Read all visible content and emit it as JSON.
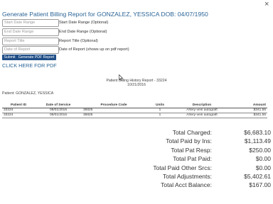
{
  "header": {
    "title": "Generate Patient Billing Report for GONZALEZ, YESSICA DOB: 04/07/1950",
    "close_glyph": "×"
  },
  "form": {
    "fields": [
      {
        "placeholder": "Start Date Range",
        "label": "Start Date Range (Optional)"
      },
      {
        "placeholder": "End Date Range",
        "label": "End Date Range (Optional)"
      },
      {
        "placeholder": "Report Title",
        "label": "Report Title (Optional)"
      },
      {
        "placeholder": "Date of Report",
        "label": "Date of Report (shows up on pdf report)"
      }
    ],
    "submit_label": "Submit",
    "generate_pdf_label": "Generate PDF Report",
    "pdf_link": "CLICK HERE FOR PDF"
  },
  "report": {
    "title": "Patient Billing History Report - 33224",
    "date": "10/21/2016",
    "patient_line": "Patient: GONZALEZ, YESSICA",
    "columns": [
      "Patient ID",
      "Date of Service",
      "Procedure Code",
      "Units",
      "Description",
      "Amount"
    ],
    "rows": [
      [
        "33224",
        "08/01/2016",
        "36825",
        "1",
        "Artery-vein autograft",
        "$341.55"
      ],
      [
        "33224",
        "08/01/2016",
        "36825",
        "1",
        "Artery-vein autograft",
        "$341.55"
      ]
    ]
  },
  "totals": [
    {
      "label": "Total Charged:",
      "value": "$6,683.10"
    },
    {
      "label": "Total Paid by Ins:",
      "value": "$1,113.49"
    },
    {
      "label": "Total Pat Resp:",
      "value": "$250.00"
    },
    {
      "label": "Total Pat Paid:",
      "value": "$0.00"
    },
    {
      "label": "Total Paid Other Srcs:",
      "value": "$0.00"
    },
    {
      "label": "Total Adjustments:",
      "value": "$5,402.61"
    },
    {
      "label": "Total Acct Balance:",
      "value": "$167.00"
    }
  ],
  "colors": {
    "link": "#2a6496",
    "button": "#1f4d86"
  }
}
